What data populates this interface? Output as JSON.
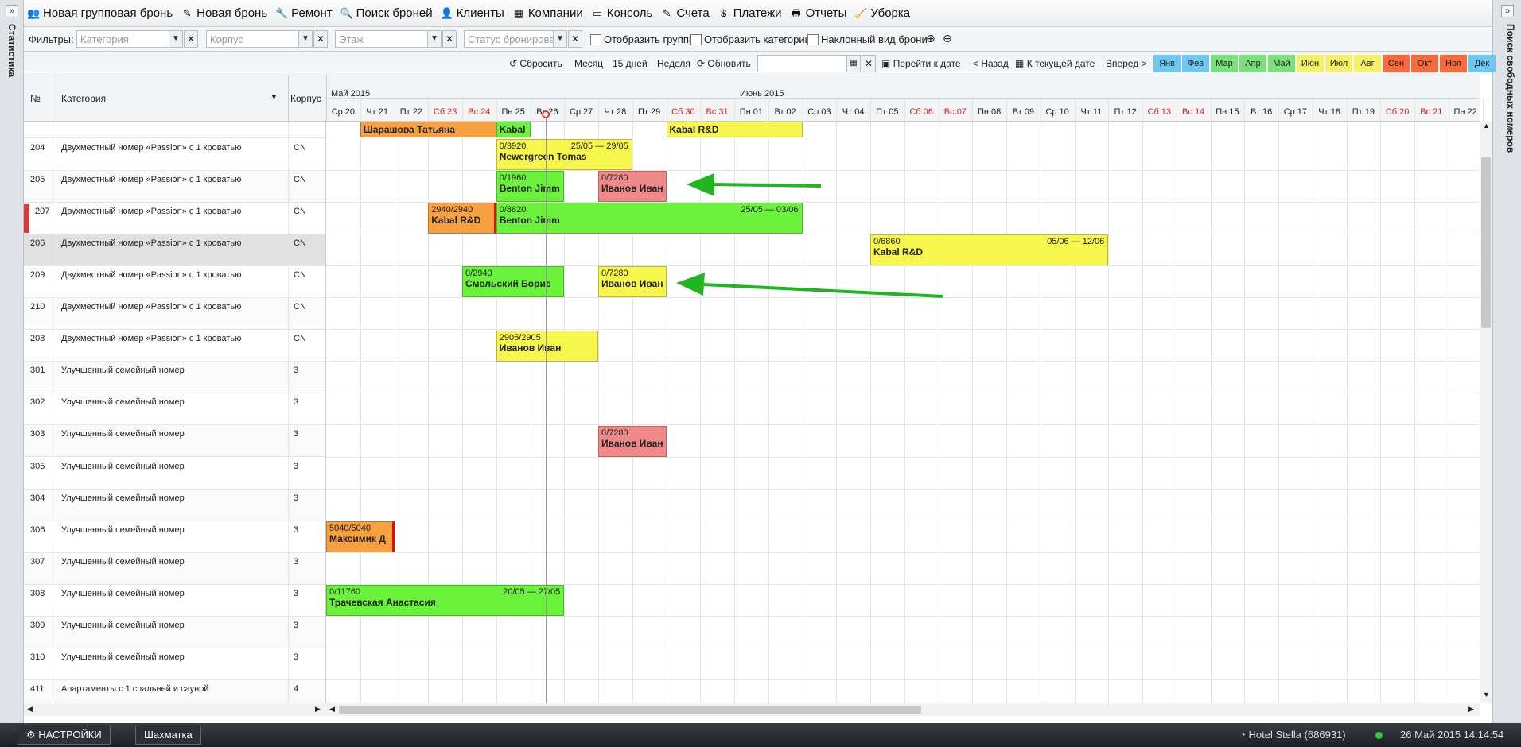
{
  "sidebars": {
    "left_label": "Статистика",
    "right_label": "Поиск свободных номеров",
    "toggle": "»"
  },
  "menu": [
    {
      "id": "new-group-booking",
      "label": "Новая групповая бронь",
      "icon": "👥"
    },
    {
      "id": "new-booking",
      "label": "Новая бронь",
      "icon": "✎"
    },
    {
      "id": "repair",
      "label": "Ремонт",
      "icon": "🔧"
    },
    {
      "id": "search-bookings",
      "label": "Поиск броней",
      "icon": "🔍"
    },
    {
      "id": "clients",
      "label": "Клиенты",
      "icon": "👤"
    },
    {
      "id": "companies",
      "label": "Компании",
      "icon": "▦"
    },
    {
      "id": "console",
      "label": "Консоль",
      "icon": "▭"
    },
    {
      "id": "invoices",
      "label": "Счета",
      "icon": "✎"
    },
    {
      "id": "payments",
      "label": "Платежи",
      "icon": "$"
    },
    {
      "id": "reports",
      "label": "Отчеты",
      "icon": "🖶"
    },
    {
      "id": "cleaning",
      "label": "Уборка",
      "icon": "🧹"
    }
  ],
  "filters": {
    "label": "Фильтры:",
    "category_placeholder": "Категория",
    "building_placeholder": "Корпус",
    "floor_placeholder": "Этаж",
    "status_placeholder": "Статус бронирован",
    "show_groups": "Отобразить группы",
    "show_categories": "Отобразить категории",
    "tilted_view": "Наклонный вид брони",
    "zoom_in": "⊕",
    "zoom_out": "⊖"
  },
  "toolbar": {
    "reset": "Сбросить",
    "month": "Месяц",
    "days15": "15 дней",
    "week": "Неделя",
    "refresh": "Обновить",
    "goto_date": "Перейти к дате",
    "back": "< Назад",
    "current_date": "К текущей дате",
    "forward": "Вперед >",
    "months": [
      {
        "label": "Янв",
        "color": "#6dc7f0"
      },
      {
        "label": "Фев",
        "color": "#6dc7f0"
      },
      {
        "label": "Мар",
        "color": "#7be07b"
      },
      {
        "label": "Апр",
        "color": "#7be07b"
      },
      {
        "label": "Май",
        "color": "#7be07b"
      },
      {
        "label": "Июн",
        "color": "#f5f06a"
      },
      {
        "label": "Июл",
        "color": "#f5f06a"
      },
      {
        "label": "Авг",
        "color": "#f5f06a"
      },
      {
        "label": "Сен",
        "color": "#f76a3b"
      },
      {
        "label": "Окт",
        "color": "#f76a3b"
      },
      {
        "label": "Ноя",
        "color": "#f76a3b"
      },
      {
        "label": "Дек",
        "color": "#6dc7f0"
      }
    ]
  },
  "grid": {
    "col_num": "№",
    "col_category": "Категория",
    "col_building": "Корпус",
    "month1": "Май 2015",
    "month2": "Июнь 2015",
    "days": [
      {
        "label": "Ср 20",
        "weekend": false
      },
      {
        "label": "Чт 21",
        "weekend": false
      },
      {
        "label": "Пт 22",
        "weekend": false
      },
      {
        "label": "Сб 23",
        "weekend": true
      },
      {
        "label": "Вс 24",
        "weekend": true
      },
      {
        "label": "Пн 25",
        "weekend": false
      },
      {
        "label": "Вт 26",
        "weekend": false
      },
      {
        "label": "Ср 27",
        "weekend": false
      },
      {
        "label": "Чт 28",
        "weekend": false
      },
      {
        "label": "Пт 29",
        "weekend": false
      },
      {
        "label": "Сб 30",
        "weekend": true
      },
      {
        "label": "Вс 31",
        "weekend": true
      },
      {
        "label": "Пн 01",
        "weekend": false
      },
      {
        "label": "Вт 02",
        "weekend": false
      },
      {
        "label": "Ср 03",
        "weekend": false
      },
      {
        "label": "Чт 04",
        "weekend": false
      },
      {
        "label": "Пт 05",
        "weekend": false
      },
      {
        "label": "Сб 06",
        "weekend": true
      },
      {
        "label": "Вс 07",
        "weekend": true
      },
      {
        "label": "Пн 08",
        "weekend": false
      },
      {
        "label": "Вт 09",
        "weekend": false
      },
      {
        "label": "Ср 10",
        "weekend": false
      },
      {
        "label": "Чт 11",
        "weekend": false
      },
      {
        "label": "Пт 12",
        "weekend": false
      },
      {
        "label": "Сб 13",
        "weekend": true
      },
      {
        "label": "Вс 14",
        "weekend": true
      },
      {
        "label": "Пн 15",
        "weekend": false
      },
      {
        "label": "Вт 16",
        "weekend": false
      },
      {
        "label": "Ср 17",
        "weekend": false
      },
      {
        "label": "Чт 18",
        "weekend": false
      },
      {
        "label": "Пт 19",
        "weekend": false
      },
      {
        "label": "Сб 20",
        "weekend": true
      },
      {
        "label": "Вс 21",
        "weekend": true
      },
      {
        "label": "Пн 22",
        "weekend": false
      }
    ],
    "rows": [
      {
        "num": "204",
        "cat": "Двухместный номер «Passion» с 1 кроватью",
        "bld": "CN"
      },
      {
        "num": "205",
        "cat": "Двухместный номер «Passion» с 1 кроватью",
        "bld": "CN"
      },
      {
        "num": "207",
        "cat": "Двухместный номер «Passion» с 1 кроватью",
        "bld": "CN",
        "flag": true
      },
      {
        "num": "206",
        "cat": "Двухместный номер «Passion» с 1 кроватью",
        "bld": "CN",
        "selected": true
      },
      {
        "num": "209",
        "cat": "Двухместный номер «Passion» с 1 кроватью",
        "bld": "CN"
      },
      {
        "num": "210",
        "cat": "Двухместный номер «Passion» с 1 кроватью",
        "bld": "CN"
      },
      {
        "num": "208",
        "cat": "Двухместный номер «Passion» с 1 кроватью",
        "bld": "CN"
      },
      {
        "num": "301",
        "cat": "Улучшенный семейный номер",
        "bld": "3"
      },
      {
        "num": "302",
        "cat": "Улучшенный семейный номер",
        "bld": "3"
      },
      {
        "num": "303",
        "cat": "Улучшенный семейный номер",
        "bld": "3"
      },
      {
        "num": "305",
        "cat": "Улучшенный семейный номер",
        "bld": "3"
      },
      {
        "num": "304",
        "cat": "Улучшенный семейный номер",
        "bld": "3"
      },
      {
        "num": "306",
        "cat": "Улучшенный семейный номер",
        "bld": "3"
      },
      {
        "num": "307",
        "cat": "Улучшенный семейный номер",
        "bld": "3"
      },
      {
        "num": "308",
        "cat": "Улучшенный семейный номер",
        "bld": "3"
      },
      {
        "num": "309",
        "cat": "Улучшенный семейный номер",
        "bld": "3"
      },
      {
        "num": "310",
        "cat": "Улучшенный семейный номер",
        "bld": "3"
      },
      {
        "num": "411",
        "cat": "Апартаменты с 1 спальней и сауной",
        "bld": "4"
      }
    ],
    "bookings": [
      {
        "row": -1,
        "start": 1,
        "days": 5,
        "amt": "",
        "name": "Шарашова Татьяна",
        "dates": "",
        "color": "#f7a040",
        "edge": true
      },
      {
        "row": -1,
        "start": 5,
        "days": 1,
        "amt": "",
        "name": "Kabal",
        "dates": "",
        "color": "#6bf23a"
      },
      {
        "row": -1,
        "start": 10,
        "days": 4,
        "amt": "",
        "name": "Kabal R&D",
        "dates": "",
        "color": "#f6f64c"
      },
      {
        "row": 0,
        "start": 5,
        "days": 4,
        "amt": "0/3920",
        "name": "Newergreen Tomas",
        "dates": "25/05 — 29/05",
        "color": "#f6f64c"
      },
      {
        "row": 1,
        "start": 5,
        "days": 2,
        "amt": "0/1960",
        "name": "Benton Jimm",
        "dates": "",
        "color": "#6bf23a"
      },
      {
        "row": 1,
        "start": 8,
        "days": 2,
        "amt": "0/7280",
        "name": "Иванов Иван",
        "dates": "",
        "color": "#f08a8a"
      },
      {
        "row": 2,
        "start": 3,
        "days": 2,
        "amt": "2940/2940",
        "name": "Kabal R&D",
        "dates": "",
        "color": "#f7a040",
        "edge": true
      },
      {
        "row": 2,
        "start": 5,
        "days": 9,
        "amt": "0/8820",
        "name": "Benton Jimm",
        "dates": "25/05 — 03/06",
        "color": "#6bf23a"
      },
      {
        "row": 3,
        "start": 16,
        "days": 7,
        "amt": "0/6860",
        "name": "Kabal R&D",
        "dates": "05/06 — 12/06",
        "color": "#f6f64c"
      },
      {
        "row": 4,
        "start": 4,
        "days": 3,
        "amt": "0/2940",
        "name": "Смольский Борис",
        "dates": "",
        "color": "#6bf23a"
      },
      {
        "row": 4,
        "start": 8,
        "days": 2,
        "amt": "0/7280",
        "name": "Иванов Иван",
        "dates": "",
        "color": "#f6f64c"
      },
      {
        "row": 6,
        "start": 5,
        "days": 3,
        "amt": "2905/2905",
        "name": "Иванов Иван",
        "dates": "",
        "color": "#f6f64c"
      },
      {
        "row": 9,
        "start": 8,
        "days": 2,
        "amt": "0/7280",
        "name": "Иванов Иван",
        "dates": "",
        "color": "#f08a8a"
      },
      {
        "row": 12,
        "start": 0,
        "days": 2,
        "amt": "5040/5040",
        "name": "Максимик Д",
        "dates": "",
        "color": "#f7a040",
        "edge": true
      },
      {
        "row": 14,
        "start": 0,
        "days": 7,
        "amt": "0/11760",
        "name": "Трачевская Анастасия",
        "dates": "20/05 — 27/05",
        "color": "#6bf23a"
      }
    ]
  },
  "taskbar": {
    "settings": "НАСТРОЙКИ",
    "chess": "Шахматка",
    "hotel": "Hotel Stella (686931)",
    "datetime": "26 Май 2015 14:14:54"
  }
}
